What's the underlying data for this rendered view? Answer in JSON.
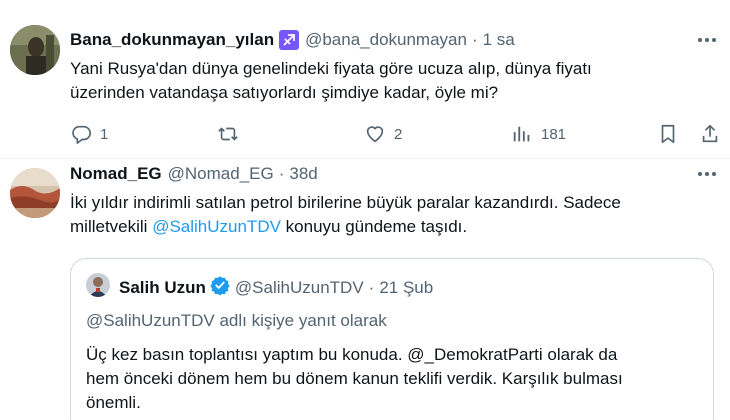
{
  "tweet1": {
    "display_name": "Bana_dokunmayan_yılan",
    "zodiac_icon": "sagittarius-icon",
    "handle": "@bana_dokunmayan",
    "separator": "·",
    "time": "1 sa",
    "text_line1": "Yani Rusya'dan dünya genelindeki fiyata göre ucuza alıp, dünya fiyatı",
    "text_line2": "üzerinden vatandaşa satıyorlardı şimdiye kadar, öyle mi?",
    "replies": "1",
    "retweets": "",
    "likes": "2",
    "views": "181"
  },
  "tweet2": {
    "display_name": "Nomad_EG",
    "handle": "@Nomad_EG",
    "separator": "·",
    "time": "38d",
    "text_line1": "İki yıldır indirimli satılan petrol birilerine büyük paralar kazandırdı. Sadece",
    "text_line2_prefix": "milletvekili ",
    "text_line2_mention": "@SalihUzunTDV",
    "text_line2_suffix": " konuyu gündeme taşıdı."
  },
  "quote": {
    "display_name": "Salih Uzun",
    "handle": "@SalihUzunTDV",
    "separator": "·",
    "time": "21 Şub",
    "reply_context": "@SalihUzunTDV adlı kişiye yanıt olarak",
    "text_line1": "Üç kez basın toplantısı yaptım bu konuda. @_DemokratParti olarak da",
    "text_line2": "hem önceki dönem hem bu dönem kanun teklifi verdik. Karşılık bulması",
    "text_line3": "önemli."
  },
  "colors": {
    "text": "#0f1419",
    "secondary": "#536471",
    "accent": "#1d9bf0",
    "zodiac_bg": "#7856ff",
    "border": "#cfd9de"
  }
}
